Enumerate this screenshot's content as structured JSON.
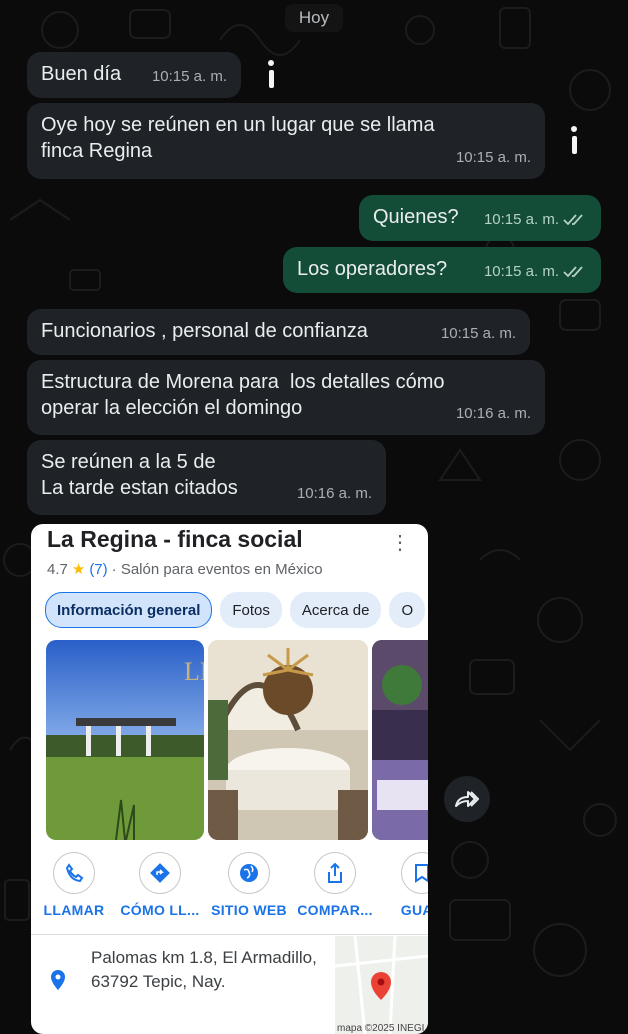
{
  "day_divider": "Hoy",
  "messages": [
    {
      "dir": "in",
      "text": "Buen día",
      "time": "10:15 a. m."
    },
    {
      "dir": "in",
      "text": "Oye hoy se reúnen en un lugar que se llama\nfinca Regina",
      "time": "10:15 a. m."
    },
    {
      "dir": "out",
      "text": "Quienes?",
      "time": "10:15 a. m.",
      "status": "read"
    },
    {
      "dir": "out",
      "text": "Los operadores?",
      "time": "10:15 a. m.",
      "status": "read"
    },
    {
      "dir": "in",
      "text": "Funcionarios , personal de confianza",
      "time": "10:15 a. m."
    },
    {
      "dir": "in",
      "text": "Estructura de Morena para  los detalles cómo\noperar la elección el domingo",
      "time": "10:16 a. m."
    },
    {
      "dir": "in",
      "text": "Se reúnen a la 5 de\nLa tarde estan citados",
      "time": "10:16 a. m."
    }
  ],
  "place_card": {
    "title": "La Regina - finca social",
    "more_icon": "more-vert-icon",
    "rating": "4.7",
    "review_count": "(7)",
    "category": "· Salón para eventos en México",
    "tabs": [
      "Información general",
      "Fotos",
      "Acerca de",
      "O"
    ],
    "active_tab": "Información general",
    "actions": [
      {
        "label": "LLAMAR",
        "icon": "phone-icon"
      },
      {
        "label": "CÓMO LL...",
        "icon": "directions-icon"
      },
      {
        "label": "SITIO WEB",
        "icon": "globe-icon"
      },
      {
        "label": "COMPAR...",
        "icon": "share-icon"
      },
      {
        "label": "GUAR",
        "icon": "bookmark-icon"
      }
    ],
    "address": "Palomas km 1.8, El Armadillo, 63792 Tepic, Nay.",
    "map_credit": "mapa ©2025 INEGI",
    "photo_logo": "LR"
  },
  "colors": {
    "incoming_bubble": "#1f2327",
    "outgoing_bubble": "#144d37",
    "link_blue": "#1a73e8",
    "map_pin": "#ea4335"
  }
}
